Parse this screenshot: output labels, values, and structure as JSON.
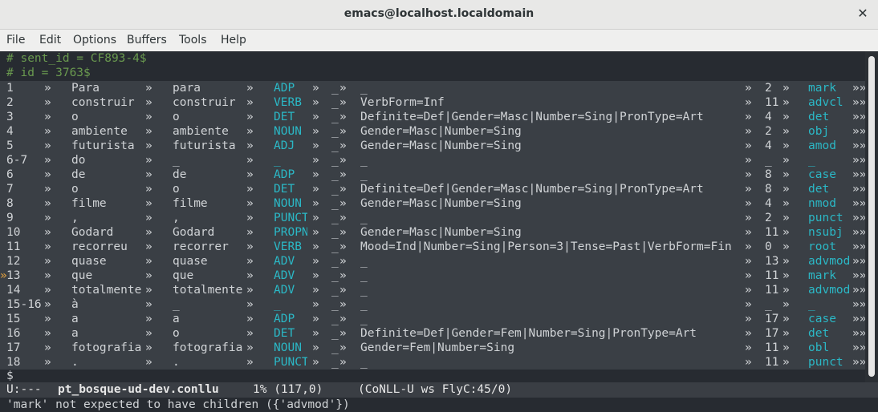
{
  "window": {
    "title": "emacs@localhost.localdomain",
    "close_glyph": "✕"
  },
  "menubar": {
    "items": [
      "File",
      "Edit",
      "Options",
      "Buffers",
      "Tools",
      "Help"
    ]
  },
  "buffer": {
    "comments": [
      "# sent_id = CF893-4$",
      "# id = 3763$"
    ],
    "rows": [
      {
        "id": "1",
        "form": "Para",
        "lemma": "para",
        "upos": "ADP",
        "xpos": "_",
        "feats": "_",
        "head": "2",
        "deprel": "mark"
      },
      {
        "id": "2",
        "form": "construir",
        "lemma": "construir",
        "upos": "VERB",
        "xpos": "_",
        "feats": "VerbForm=Inf",
        "head": "11",
        "deprel": "advcl"
      },
      {
        "id": "3",
        "form": "o",
        "lemma": "o",
        "upos": "DET",
        "xpos": "_",
        "feats": "Definite=Def|Gender=Masc|Number=Sing|PronType=Art",
        "head": "4",
        "deprel": "det"
      },
      {
        "id": "4",
        "form": "ambiente",
        "lemma": "ambiente",
        "upos": "NOUN",
        "xpos": "_",
        "feats": "Gender=Masc|Number=Sing",
        "head": "2",
        "deprel": "obj"
      },
      {
        "id": "5",
        "form": "futurista",
        "lemma": "futurista",
        "upos": "ADJ",
        "xpos": "_",
        "feats": "Gender=Masc|Number=Sing",
        "head": "4",
        "deprel": "amod"
      },
      {
        "id": "6-7",
        "form": "do",
        "lemma": "_",
        "upos": "_",
        "xpos": "_",
        "feats": "_",
        "head": "_",
        "deprel": "_"
      },
      {
        "id": "6",
        "form": "de",
        "lemma": "de",
        "upos": "ADP",
        "xpos": "_",
        "feats": "_",
        "head": "8",
        "deprel": "case"
      },
      {
        "id": "7",
        "form": "o",
        "lemma": "o",
        "upos": "DET",
        "xpos": "_",
        "feats": "Definite=Def|Gender=Masc|Number=Sing|PronType=Art",
        "head": "8",
        "deprel": "det"
      },
      {
        "id": "8",
        "form": "filme",
        "lemma": "filme",
        "upos": "NOUN",
        "xpos": "_",
        "feats": "Gender=Masc|Number=Sing",
        "head": "4",
        "deprel": "nmod"
      },
      {
        "id": "9",
        "form": ",",
        "lemma": ",",
        "upos": "PUNCT",
        "xpos": "_",
        "feats": "_",
        "head": "2",
        "deprel": "punct"
      },
      {
        "id": "10",
        "form": "Godard",
        "lemma": "Godard",
        "upos": "PROPN",
        "xpos": "_",
        "feats": "Gender=Masc|Number=Sing",
        "head": "11",
        "deprel": "nsubj"
      },
      {
        "id": "11",
        "form": "recorreu",
        "lemma": "recorrer",
        "upos": "VERB",
        "xpos": "_",
        "feats": "Mood=Ind|Number=Sing|Person=3|Tense=Past|VerbForm=Fin",
        "head": "0",
        "deprel": "root"
      },
      {
        "id": "12",
        "form": "quase",
        "lemma": "quase",
        "upos": "ADV",
        "xpos": "_",
        "feats": "_",
        "head": "13",
        "deprel": "advmod"
      },
      {
        "id": "13",
        "form": "que",
        "lemma": "que",
        "upos": "ADV",
        "xpos": "_",
        "feats": "_",
        "head": "11",
        "deprel": "mark",
        "flagged": true
      },
      {
        "id": "14",
        "form": "totalmente",
        "lemma": "totalmente",
        "upos": "ADV",
        "xpos": "_",
        "feats": "_",
        "head": "11",
        "deprel": "advmod"
      },
      {
        "id": "15-16",
        "form": "à",
        "lemma": "_",
        "upos": "_",
        "xpos": "_",
        "feats": "_",
        "head": "_",
        "deprel": "_"
      },
      {
        "id": "15",
        "form": "a",
        "lemma": "a",
        "upos": "ADP",
        "xpos": "_",
        "feats": "_",
        "head": "17",
        "deprel": "case"
      },
      {
        "id": "16",
        "form": "a",
        "lemma": "o",
        "upos": "DET",
        "xpos": "_",
        "feats": "Definite=Def|Gender=Fem|Number=Sing|PronType=Art",
        "head": "17",
        "deprel": "det"
      },
      {
        "id": "17",
        "form": "fotografia",
        "lemma": "fotografia",
        "upos": "NOUN",
        "xpos": "_",
        "feats": "Gender=Fem|Number=Sing",
        "head": "11",
        "deprel": "obl"
      },
      {
        "id": "18",
        "form": ".",
        "lemma": ".",
        "upos": "PUNCT",
        "xpos": "_",
        "feats": "_",
        "head": "11",
        "deprel": "punct"
      }
    ],
    "tab_glyph": "»",
    "overflow_glyph": "»»",
    "last_line": "$"
  },
  "modeline": {
    "status": "U:---",
    "buffer_name": "pt_bosque-ud-dev.conllu",
    "position": "1% (117,0)",
    "modes": "(CoNLL-U ws FlyC:45/0)"
  },
  "echo": {
    "message": "'mark' not expected to have children ({'advmod'})"
  }
}
